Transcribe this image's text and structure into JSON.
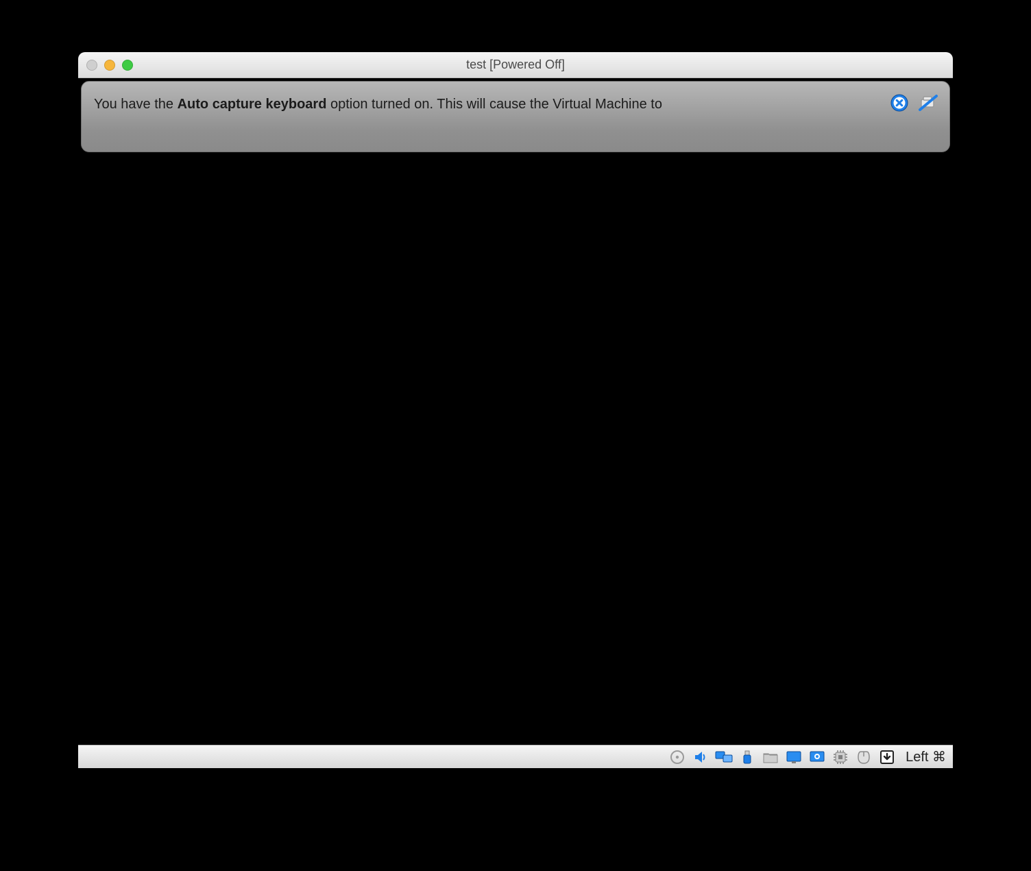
{
  "window": {
    "title": "test [Powered Off]"
  },
  "notification": {
    "prefix": "You have the ",
    "bold": "Auto capture keyboard",
    "suffix": " option turned on. This will cause the Virtual Machine to"
  },
  "statusbar": {
    "hostkey": "Left ⌘",
    "icons": {
      "optical": "optical-drive-icon",
      "audio": "audio-icon",
      "network": "network-icon",
      "usb": "usb-icon",
      "shared": "shared-folder-icon",
      "display": "display-icon",
      "recording": "recording-icon",
      "cpu": "cpu-icon",
      "mouse": "mouse-integration-icon",
      "keyboard": "keyboard-capture-icon"
    }
  }
}
